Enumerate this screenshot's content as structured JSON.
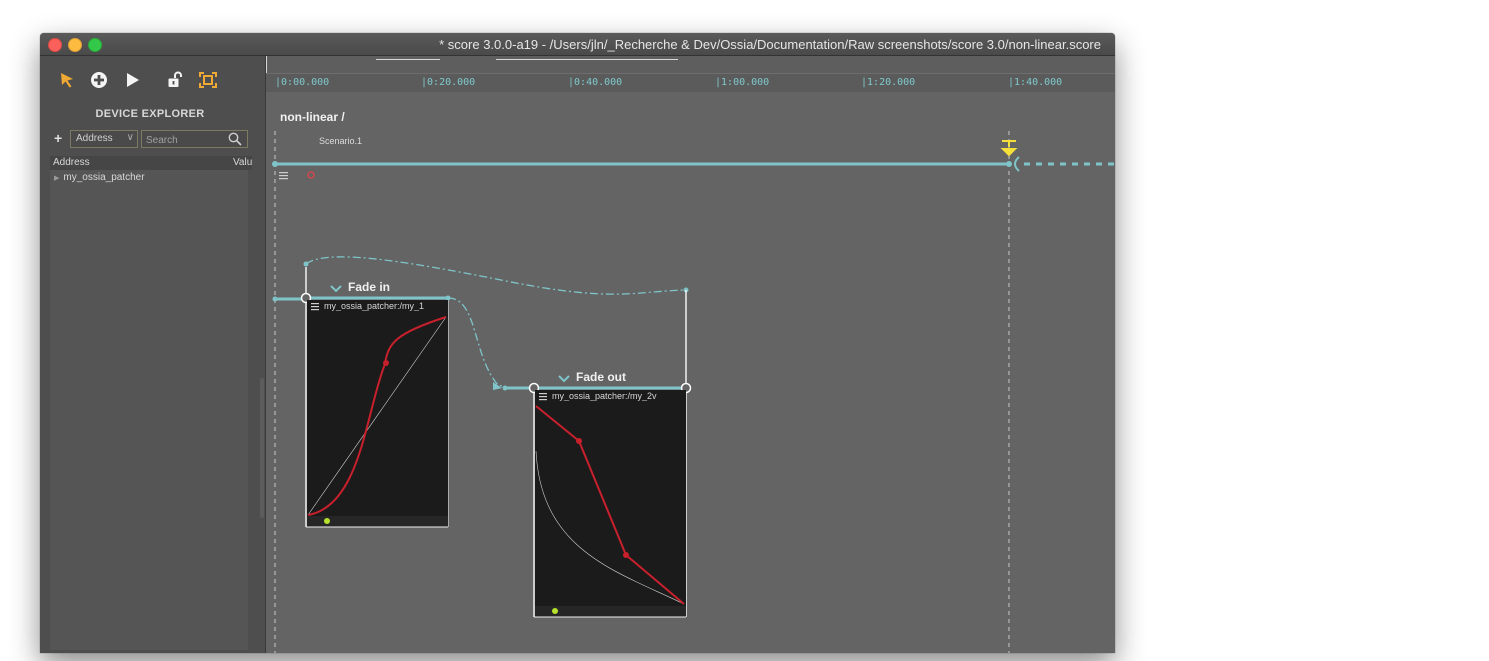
{
  "window": {
    "title": "* score 3.0.0-a19 - /Users/jln/_Recherche & Dev/Ossia/Documentation/Raw screenshots/score 3.0/non-linear.score"
  },
  "toolbar": {
    "tools": [
      "select-tool",
      "create-tool",
      "play-tool",
      "lock-tool",
      "scale-tool"
    ]
  },
  "device_explorer": {
    "title": "DEVICE EXPLORER",
    "add_label": "+",
    "address_select": "Address",
    "search_placeholder": "Search",
    "columns": {
      "address": "Address",
      "value": "Value"
    },
    "items": [
      "my_ossia_patcher"
    ]
  },
  "timeline": {
    "ruler_ticks": [
      "0:00.000",
      "0:20.000",
      "0:40.000",
      "1:00.000",
      "1:20.000",
      "1:40.000"
    ],
    "breadcrumb": "non-linear /",
    "scenario_name": "Scenario.1",
    "colors": {
      "accent": "#7fc4c9",
      "curve": "#c8202c",
      "playhead": "#f5e03a",
      "dot": "#b7e22c"
    }
  },
  "boxes": [
    {
      "name": "Fade in",
      "process": "my_ossia_patcher:/my_1"
    },
    {
      "name": "Fade out",
      "process": "my_ossia_patcher:/my_2v"
    }
  ]
}
